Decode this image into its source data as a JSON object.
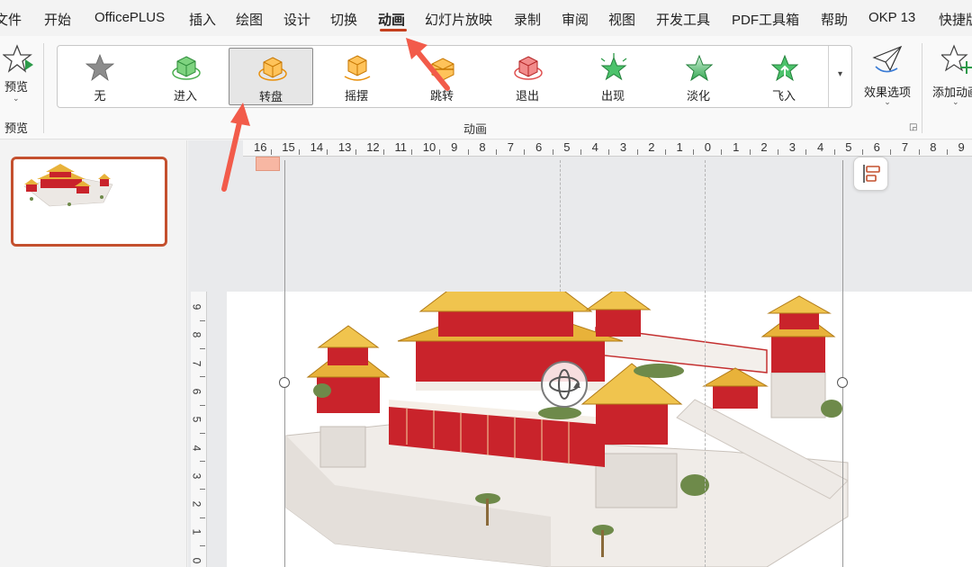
{
  "menu": {
    "tabs": [
      "文件",
      "开始",
      "OfficePLUS",
      "插入",
      "绘图",
      "设计",
      "切换",
      "动画",
      "幻灯片放映",
      "录制",
      "审阅",
      "视图",
      "开发工具",
      "PDF工具箱",
      "帮助",
      "OKP 13",
      "快捷版"
    ],
    "active_tab": "动画"
  },
  "ribbon": {
    "preview": {
      "label": "预览",
      "group_label": "预览"
    },
    "animation_group_label": "动画",
    "animations": [
      "无",
      "进入",
      "转盘",
      "摇摆",
      "跳转",
      "退出",
      "出现",
      "淡化",
      "飞入"
    ],
    "selected_animation": "转盘",
    "effect_options_label": "效果选项",
    "add_animation_label": "添加动画"
  },
  "ruler": {
    "horizontal": [
      "16",
      "15",
      "14",
      "13",
      "12",
      "11",
      "10",
      "9",
      "8",
      "7",
      "6",
      "5",
      "4",
      "3",
      "2",
      "1",
      "0",
      "1",
      "2",
      "3",
      "4",
      "5",
      "6",
      "7",
      "8",
      "9"
    ],
    "vertical": [
      "9",
      "8",
      "7",
      "6",
      "5",
      "4",
      "3",
      "2",
      "1",
      "0"
    ]
  },
  "colors": {
    "accent": "#c43e1c",
    "thumb_border": "#c4502e",
    "annotation_arrow": "#f25b4a",
    "palace_red": "#c9232b",
    "palace_gold": "#e8b23a"
  }
}
